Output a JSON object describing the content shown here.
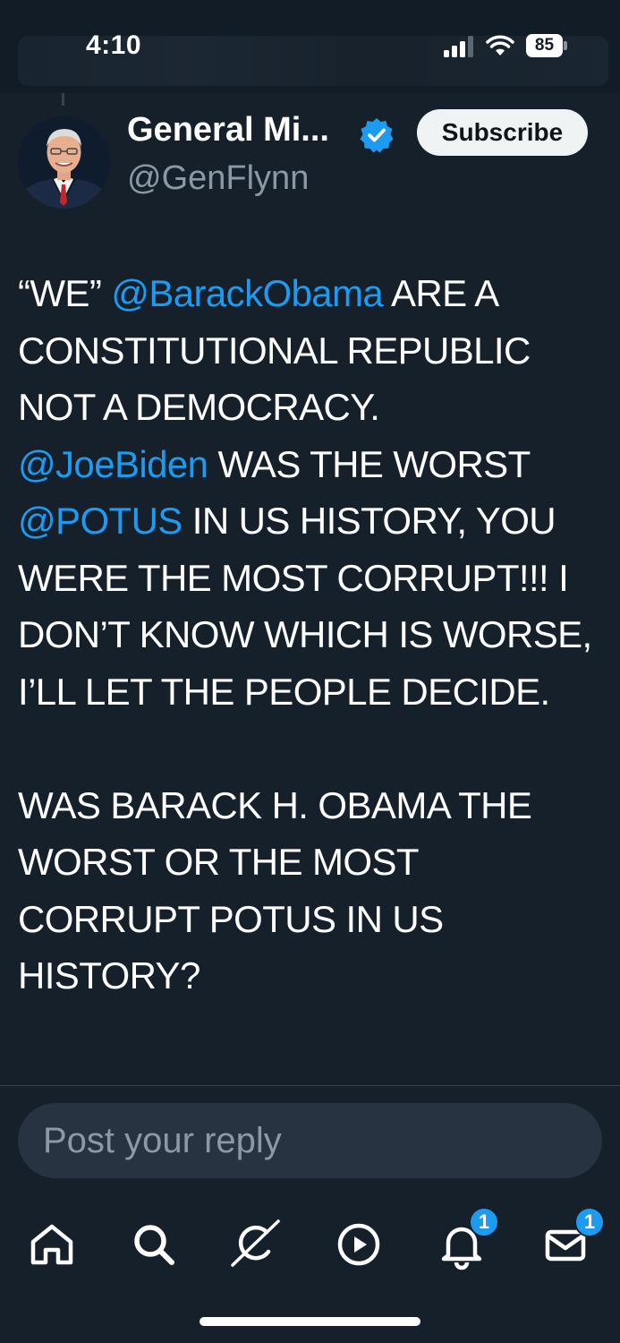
{
  "status_bar": {
    "time": "4:10",
    "battery": "85",
    "icons": [
      "signal-icon",
      "wifi-icon",
      "battery-icon"
    ]
  },
  "author": {
    "display_name": "General Mi...",
    "handle": "@GenFlynn",
    "verified": true
  },
  "actions": {
    "subscribe_label": "Subscribe"
  },
  "post": {
    "mention_color": "#1d9bf0",
    "segments": [
      {
        "text": "“WE” ",
        "type": "text"
      },
      {
        "text": "@BarackObama",
        "type": "mention"
      },
      {
        "text": " ARE A CONSTITUTIONAL REPUBLIC NOT A DEMOCRACY.",
        "type": "text"
      },
      {
        "text": "\n",
        "type": "break"
      },
      {
        "text": "@JoeBiden",
        "type": "mention"
      },
      {
        "text": " WAS THE WORST ",
        "type": "text"
      },
      {
        "text": "@POTUS",
        "type": "mention"
      },
      {
        "text": " IN US HISTORY, YOU WERE THE MOST CORRUPT!!! I DON’T KNOW WHICH IS WORSE, I’LL LET THE PEOPLE DECIDE.",
        "type": "text"
      },
      {
        "text": "\n\n",
        "type": "break"
      },
      {
        "text": "WAS BARACK H. OBAMA THE WORST OR THE MOST CORRUPT POTUS IN US HISTORY?",
        "type": "text"
      }
    ]
  },
  "reply": {
    "placeholder": "Post your reply"
  },
  "bottom_nav": {
    "items": [
      {
        "name": "home-icon",
        "badge": ""
      },
      {
        "name": "search-icon",
        "badge": ""
      },
      {
        "name": "grok-icon",
        "badge": ""
      },
      {
        "name": "play-icon",
        "badge": ""
      },
      {
        "name": "notifications-bell-icon",
        "badge": "1"
      },
      {
        "name": "messages-envelope-icon",
        "badge": "1"
      }
    ]
  },
  "colors": {
    "background": "#15202b",
    "accent": "#1d9bf0",
    "secondary_text": "#8b98a5"
  }
}
